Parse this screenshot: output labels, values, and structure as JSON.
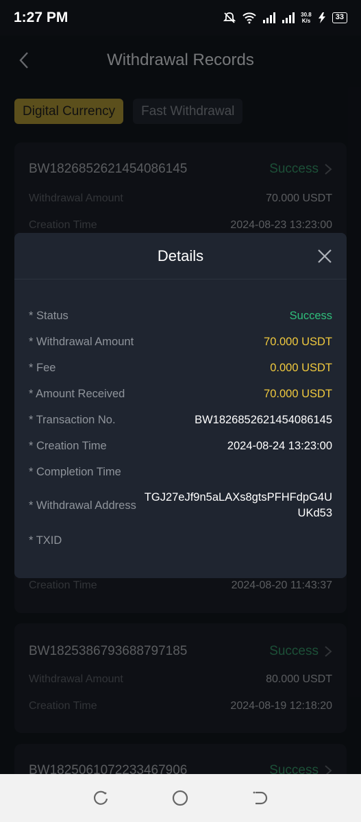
{
  "status_bar": {
    "time": "1:27 PM",
    "speed_value": "30.8",
    "speed_unit": "K/s",
    "battery": "33"
  },
  "header": {
    "title": "Withdrawal Records"
  },
  "tabs": [
    {
      "label": "Digital Currency"
    },
    {
      "label": "Fast Withdrawal"
    }
  ],
  "records": [
    {
      "order_no": "BW1826852621454086145",
      "status": "Success",
      "amount_label": "Withdrawal Amount",
      "amount": "70.000 USDT",
      "time_label": "Creation Time",
      "time": "2024-08-23 13:23:00"
    },
    {
      "time_label": "Creation Time",
      "time": "2024-08-20 11:43:37"
    },
    {
      "order_no": "BW1825386793688797185",
      "status": "Success",
      "amount_label": "Withdrawal Amount",
      "amount": "80.000 USDT",
      "time_label": "Creation Time",
      "time": "2024-08-19 12:18:20"
    },
    {
      "order_no": "BW1825061072233467906",
      "status": "Success"
    }
  ],
  "details": {
    "title": "Details",
    "rows": [
      {
        "label": "* Status",
        "value": "Success"
      },
      {
        "label": "* Withdrawal Amount",
        "value": "70.000 USDT"
      },
      {
        "label": "* Fee",
        "value": "0.000 USDT"
      },
      {
        "label": "* Amount Received",
        "value": "70.000 USDT"
      },
      {
        "label": "* Transaction No.",
        "value": "BW1826852621454086145"
      },
      {
        "label": "* Creation Time",
        "value": "2024-08-24 13:23:00"
      },
      {
        "label": "* Completion Time",
        "value": ""
      },
      {
        "label": "* Withdrawal Address",
        "value": "TGJ27eJf9n5aLAXs8gtsPFHFdpG4UUKd53"
      },
      {
        "label": "* TXID",
        "value": ""
      }
    ]
  },
  "colors": {
    "success_green": "#2fbf7b",
    "amount_gold": "#f0c93e",
    "tab_active": "#8d7a2b"
  },
  "icons": {
    "back": "chevron-left-icon",
    "close": "close-icon",
    "status_chevron": "chevron-right-icon",
    "nav_recents": "recents-icon",
    "nav_home": "home-icon",
    "nav_back": "back-icon"
  }
}
